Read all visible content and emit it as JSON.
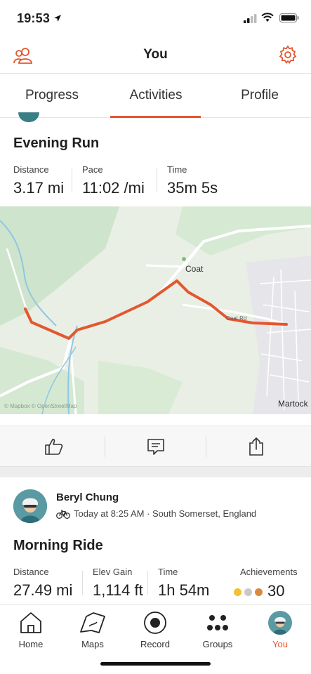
{
  "status_bar": {
    "time": "19:53"
  },
  "header": {
    "title": "You"
  },
  "tabs": [
    {
      "label": "Progress"
    },
    {
      "label": "Activities"
    },
    {
      "label": "Profile"
    }
  ],
  "activity1": {
    "title": "Evening Run",
    "stats": [
      {
        "label": "Distance",
        "value": "3.17 mi"
      },
      {
        "label": "Pace",
        "value": "11:02 /mi"
      },
      {
        "label": "Time",
        "value": "35m 5s"
      }
    ],
    "map": {
      "labels": [
        "Coat",
        "Martock"
      ],
      "road_label": "Coat Rd",
      "attribution": "© Mapbox © OpenStreetMap"
    }
  },
  "activity2": {
    "athlete": "Beryl Chung",
    "meta": "Today at 8:25 AM · South Somerset, England",
    "title": "Morning Ride",
    "stats": [
      {
        "label": "Distance",
        "value": "27.49 mi"
      },
      {
        "label": "Elev Gain",
        "value": "1,114 ft"
      },
      {
        "label": "Time",
        "value": "1h 54m"
      }
    ],
    "achievements": {
      "label": "Achievements",
      "count": "30"
    }
  },
  "bottom_nav": [
    {
      "label": "Home"
    },
    {
      "label": "Maps"
    },
    {
      "label": "Record"
    },
    {
      "label": "Groups"
    },
    {
      "label": "You"
    }
  ],
  "colors": {
    "accent": "#e4572e",
    "map_bg": "#e8efe4",
    "route": "#e4572e"
  }
}
